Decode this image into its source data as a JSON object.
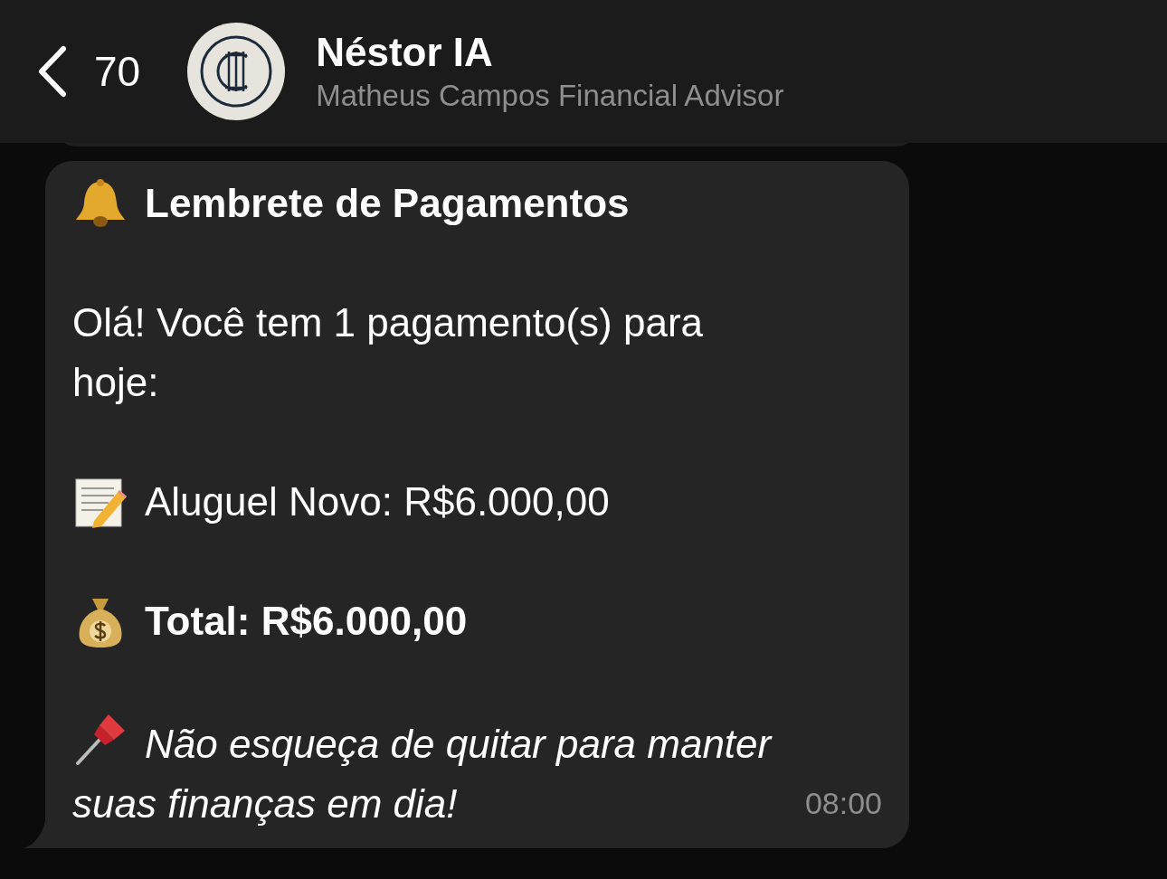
{
  "header": {
    "back_count": "70",
    "name": "Néstor IA",
    "subtitle": "Matheus Campos Financial Advisor"
  },
  "message": {
    "title": "Lembrete de Pagamentos",
    "greeting": "Olá! Você tem 1 pagamento(s) para hoje:",
    "item": "Aluguel Novo: R$6.000,00",
    "total": "Total: R$6.000,00",
    "note": "Não esqueça de quitar para manter suas finanças em dia!",
    "time": "08:00"
  }
}
